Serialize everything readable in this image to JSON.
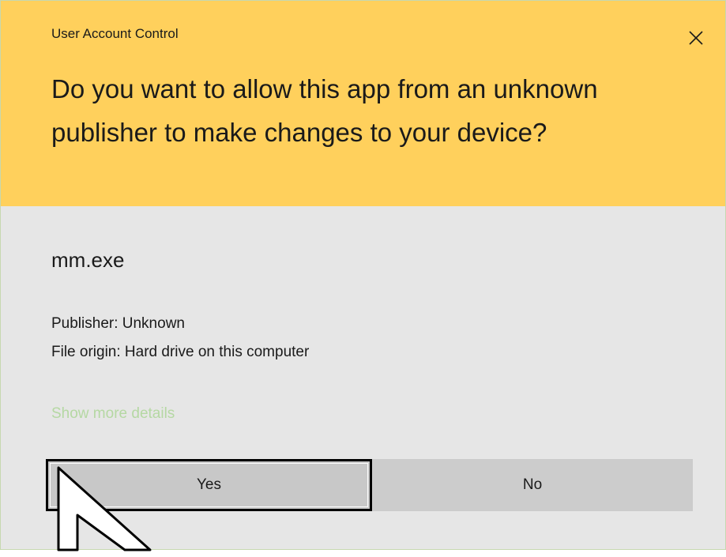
{
  "dialog": {
    "window_title": "User Account Control",
    "question": "Do you want to allow this app from an unknown publisher to make changes to your device?",
    "app_name": "mm.exe",
    "publisher": "Publisher: Unknown",
    "file_origin": "File origin: Hard drive on this computer",
    "details_link": "Show more details",
    "yes_label": "Yes",
    "no_label": "No",
    "close_icon": "close-icon"
  },
  "colors": {
    "header_bg": "#ffd05c",
    "body_bg": "#e6e6e6",
    "button_bg": "#c8c8c8",
    "link_color": "#b5d8a3",
    "focus_border": "#000000"
  }
}
